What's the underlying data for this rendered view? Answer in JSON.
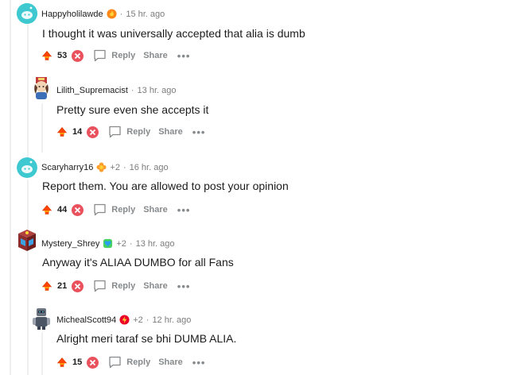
{
  "comments": [
    {
      "username": "Happyholilawde",
      "flair_icon": "flame-badge-icon",
      "extra": "",
      "time": "15 hr. ago",
      "text": "I thought it was universally accepted that alia is dumb",
      "score": "53",
      "reply_label": "Reply",
      "share_label": "Share",
      "more_label": "•••"
    },
    {
      "username": "Lilith_Supremacist",
      "flair_icon": "",
      "extra": "",
      "time": "13 hr. ago",
      "text": "Pretty sure even she accepts it",
      "score": "14",
      "reply_label": "Reply",
      "share_label": "Share",
      "more_label": "•••"
    },
    {
      "username": "Scaryharry16",
      "flair_icon": "orange-flower-badge-icon",
      "extra": "+2",
      "time": "16 hr. ago",
      "text": "Report them. You are allowed to post your opinion",
      "score": "44",
      "reply_label": "Reply",
      "share_label": "Share",
      "more_label": "•••"
    },
    {
      "username": "Mystery_Shrey",
      "flair_icon": "blue-heart-badge-icon",
      "extra": "+2",
      "time": "13 hr. ago",
      "text": "Anyway it's ALIAA DUMBO for all Fans",
      "score": "21",
      "reply_label": "Reply",
      "share_label": "Share",
      "more_label": "•••"
    },
    {
      "username": "MichealScott94",
      "flair_icon": "red-bolt-badge-icon",
      "extra": "+2",
      "time": "12 hr. ago",
      "text": "Alright meri taraf se bhi DUMB ALIA.",
      "score": "15",
      "reply_label": "Reply",
      "share_label": "Share",
      "more_label": "•••"
    }
  ],
  "colors": {
    "upvote": "#ff4500",
    "downvote": "#e9525d",
    "meta": "#7c7c7c",
    "action": "#878a8c"
  }
}
